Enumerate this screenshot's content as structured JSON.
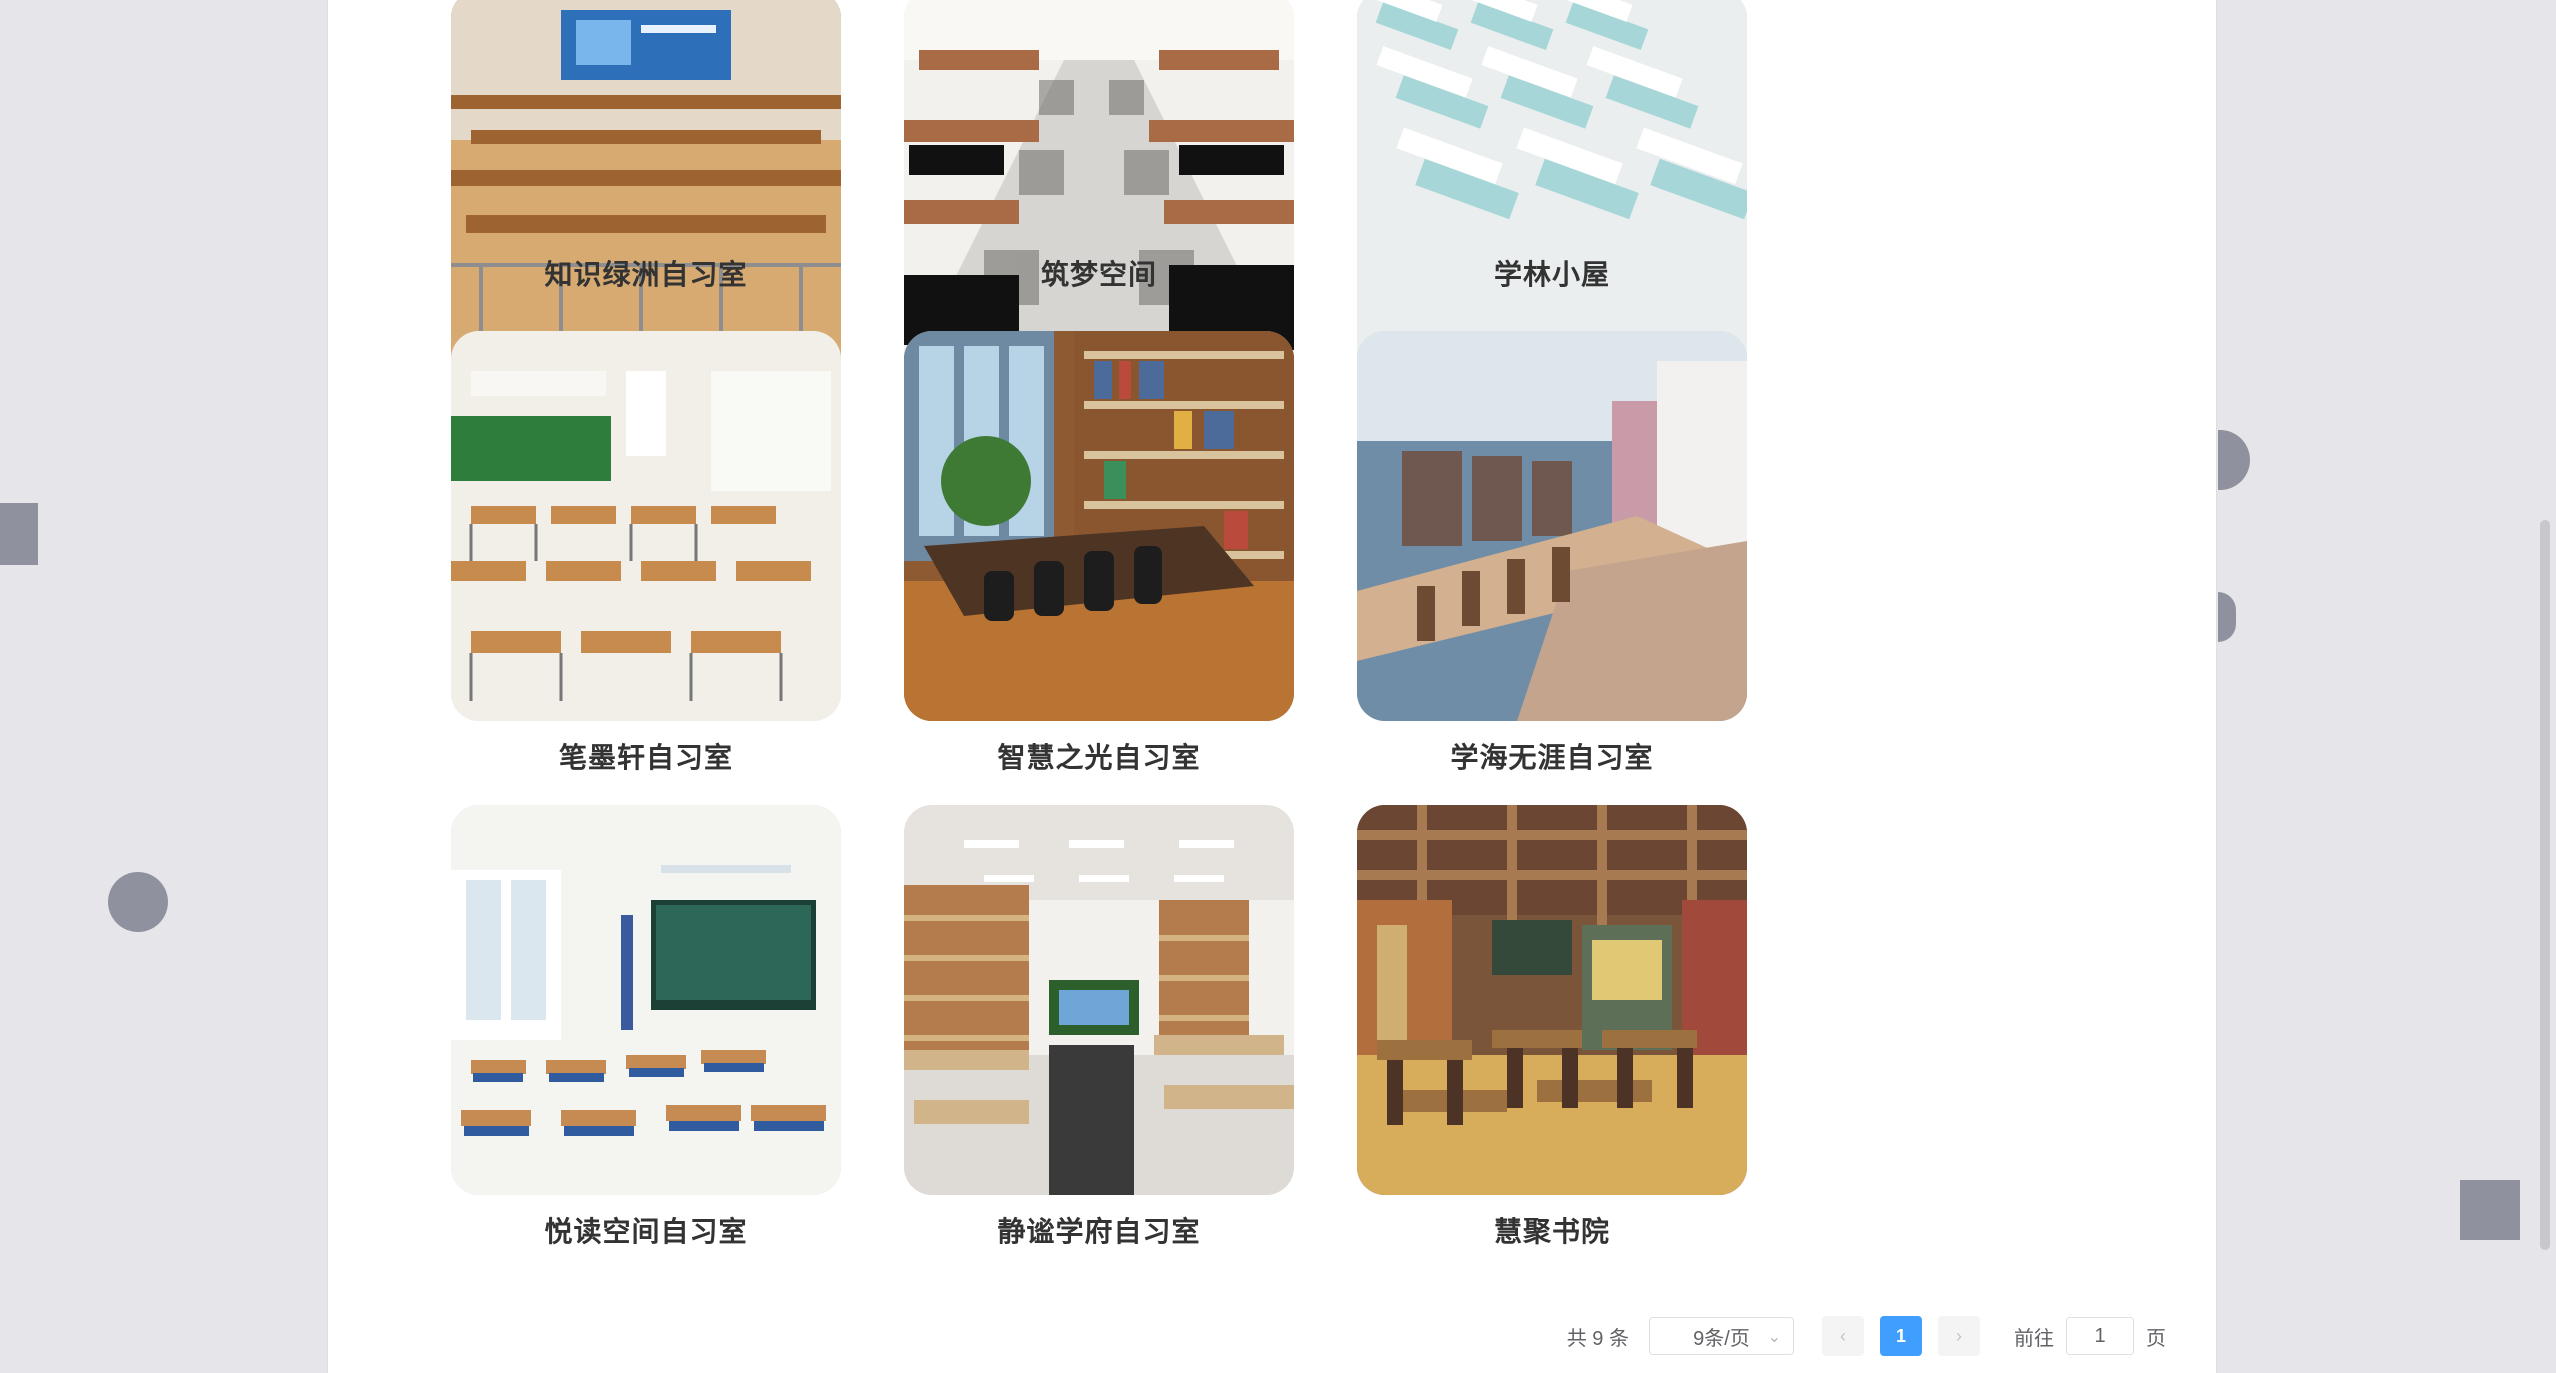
{
  "rooms": [
    {
      "name": "知识绿洲自习室",
      "image": "lecture-hall-photo"
    },
    {
      "name": "筑梦空间",
      "image": "checkered-classroom-photo"
    },
    {
      "name": "学林小屋",
      "image": "exam-hall-photo"
    },
    {
      "name": "笔墨轩自习室",
      "image": "school-classroom-photo"
    },
    {
      "name": "智慧之光自习室",
      "image": "library-room-photo"
    },
    {
      "name": "学海无涯自习室",
      "image": "long-desk-study-hall-photo"
    },
    {
      "name": "悦读空间自习室",
      "image": "blackboard-classroom-photo"
    },
    {
      "name": "静谧学府自习室",
      "image": "bookshelf-study-room-photo"
    },
    {
      "name": "慧聚书院",
      "image": "warm-reading-room-photo"
    }
  ],
  "pagination": {
    "total_text": "共 9 条",
    "page_size": "9条/页",
    "prev": "‹",
    "current_page": "1",
    "next": "›",
    "goto_prefix": "前往",
    "goto_value": "1",
    "goto_suffix": "页"
  },
  "colors": {
    "background": "#e6e6ea",
    "accent": "#409eff",
    "text": "#333333"
  }
}
